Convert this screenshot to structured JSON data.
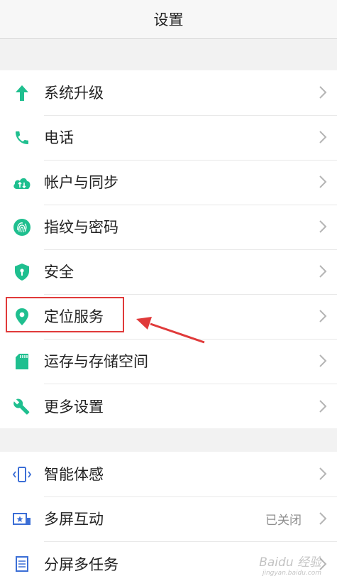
{
  "header": {
    "title": "设置"
  },
  "group1": [
    {
      "name": "system-upgrade",
      "icon": "arrow-up-icon",
      "label": "系统升级"
    },
    {
      "name": "phone",
      "icon": "phone-icon",
      "label": "电话"
    },
    {
      "name": "account-sync",
      "icon": "cloud-sync-icon",
      "label": "帐户与同步"
    },
    {
      "name": "fingerprint-password",
      "icon": "fingerprint-icon",
      "label": "指纹与密码"
    },
    {
      "name": "security",
      "icon": "shield-icon",
      "label": "安全"
    },
    {
      "name": "location-service",
      "icon": "location-pin-icon",
      "label": "定位服务"
    },
    {
      "name": "memory-storage",
      "icon": "sd-card-icon",
      "label": "运存与存储空间"
    },
    {
      "name": "more-settings",
      "icon": "wrench-icon",
      "label": "更多设置"
    }
  ],
  "group2": [
    {
      "name": "smart-motion",
      "icon": "phone-vibrate-icon",
      "label": "智能体感"
    },
    {
      "name": "multi-screen",
      "icon": "screen-star-icon",
      "label": "多屏互动",
      "status": "已关闭"
    },
    {
      "name": "split-screen",
      "icon": "split-screen-icon",
      "label": "分屏多任务"
    }
  ],
  "colors": {
    "accent": "#1fbf8f",
    "secondary_icon": "#3b6ed6",
    "annotation": "#e03a3a"
  },
  "watermark": {
    "text": "Baidu 经验",
    "sub": "jingyan.baidu.com"
  }
}
